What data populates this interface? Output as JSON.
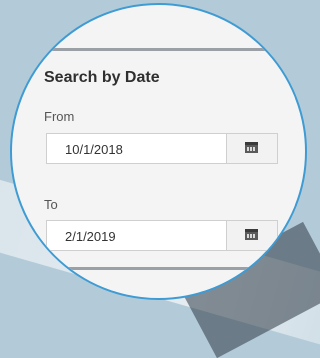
{
  "search_panel": {
    "title": "Search by Date",
    "from": {
      "label": "From",
      "value": "10/1/2018"
    },
    "to": {
      "label": "To",
      "value": "2/1/2019"
    }
  },
  "icons": {
    "date_picker": "calendar-icon"
  },
  "colors": {
    "lens_border": "#3f9bd3",
    "panel_bg": "#f4f4f4"
  }
}
